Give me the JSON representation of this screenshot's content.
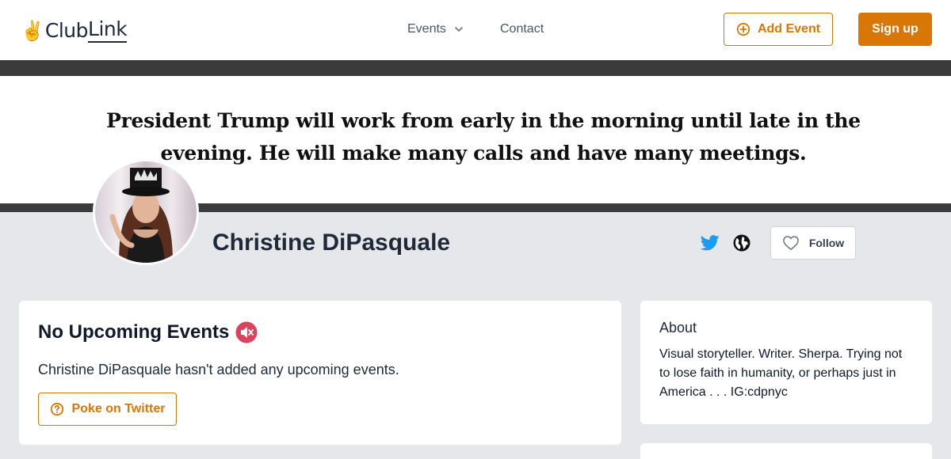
{
  "header": {
    "logo_hand": "✌",
    "logo_club": "Club",
    "logo_link": "Link",
    "nav_events": "Events",
    "nav_contact": "Contact",
    "add_event_label": "Add Event",
    "signup_label": "Sign up"
  },
  "banner": {
    "line1": "President Trump will work from early in the morning until late in the",
    "line2": "evening. He will make many calls and have many meetings."
  },
  "profile": {
    "name": "Christine DiPasquale",
    "follow_label": "Follow"
  },
  "events_card": {
    "title": "No Upcoming Events",
    "message": "Christine DiPasquale hasn't added any upcoming events.",
    "poke_label": "Poke on Twitter"
  },
  "about_card": {
    "title": "About",
    "text": "Visual storyteller. Writer. Sherpa. Trying not to lose faith in humanity, or perhaps just in America . . . IG:cdpnyc"
  },
  "colors": {
    "accent": "#d97706",
    "twitter": "#1d9bf0",
    "page_bg": "#e5e7eb"
  }
}
